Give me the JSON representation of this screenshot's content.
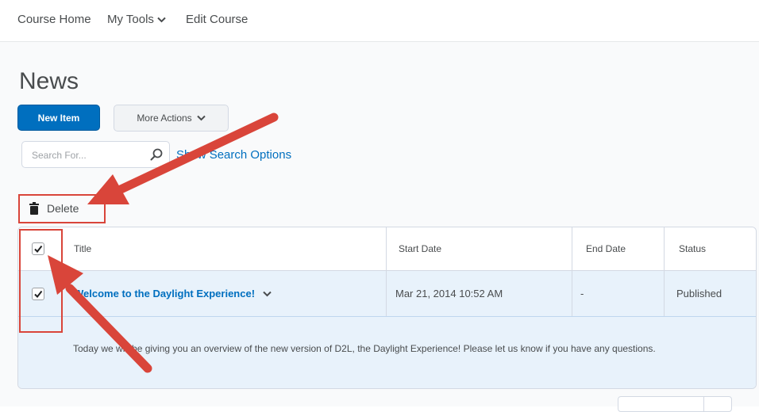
{
  "nav": {
    "items": [
      {
        "label": "Course Home"
      },
      {
        "label": "My Tools",
        "has_dropdown": true
      },
      {
        "label": "Edit Course"
      }
    ]
  },
  "page": {
    "title": "News"
  },
  "toolbar": {
    "new_item_label": "New Item",
    "more_actions_label": "More Actions"
  },
  "search": {
    "placeholder": "Search For...",
    "options_link": "Show Search Options"
  },
  "bulk_actions": {
    "delete_label": "Delete"
  },
  "table": {
    "columns": [
      "Title",
      "Start Date",
      "End Date",
      "Status"
    ],
    "rows": [
      {
        "selected": true,
        "title": "Welcome to the Daylight Experience!",
        "start_date": "Mar 21, 2014 10:52 AM",
        "end_date": "-",
        "status": "Published",
        "body": "Today we will be giving you an overview of the new version of D2L, the Daylight Experience!  Please let us know if you have any questions."
      }
    ],
    "header_checkbox_checked": true
  },
  "colors": {
    "primary": "#006fbf",
    "selected_row": "#e8f2fb",
    "annotation": "#d9453a"
  }
}
